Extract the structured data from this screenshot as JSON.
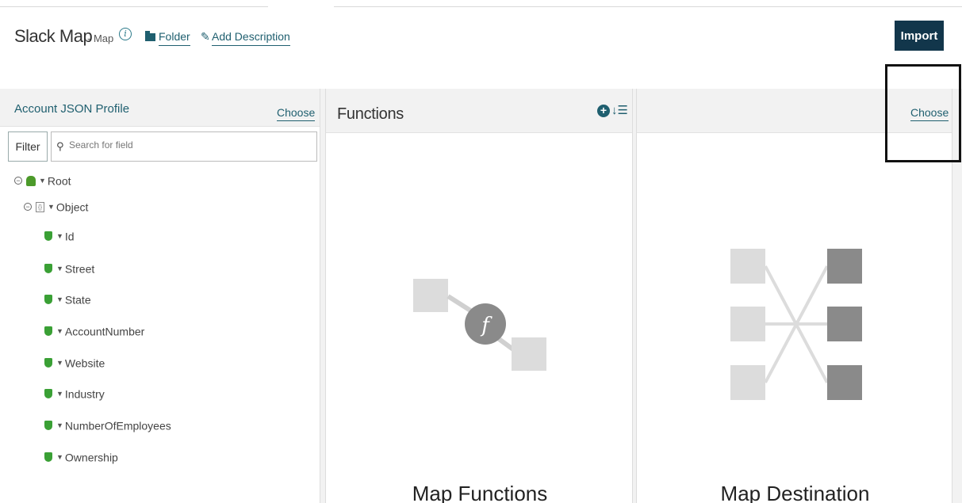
{
  "header": {
    "title": "Slack Map",
    "subtitle": "- Map",
    "info_icon": "info-icon",
    "folder_label": "Folder",
    "add_description_label": "Add Description",
    "import_label": "Import"
  },
  "source_panel": {
    "title": "Account JSON Profile",
    "choose_label": "Choose",
    "filter_label": "Filter",
    "search_placeholder": "Search for field",
    "tree": {
      "root": "Root",
      "object": "Object",
      "fields": [
        "Id",
        "Street",
        "State",
        "AccountNumber",
        "Website",
        "Industry",
        "NumberOfEmployees",
        "Ownership"
      ]
    }
  },
  "functions_panel": {
    "title": "Functions",
    "add_icon": "add-circle-icon",
    "sort_icon": "sort-icon",
    "function_glyph": "f",
    "caption": "Map Functions"
  },
  "destination_panel": {
    "choose_label": "Choose",
    "caption": "Map Destination"
  },
  "colors": {
    "link": "#1f5f6f",
    "import_button": "#12364b",
    "field_icon": "#3aa035",
    "panel_header": "#f2f2f2"
  }
}
